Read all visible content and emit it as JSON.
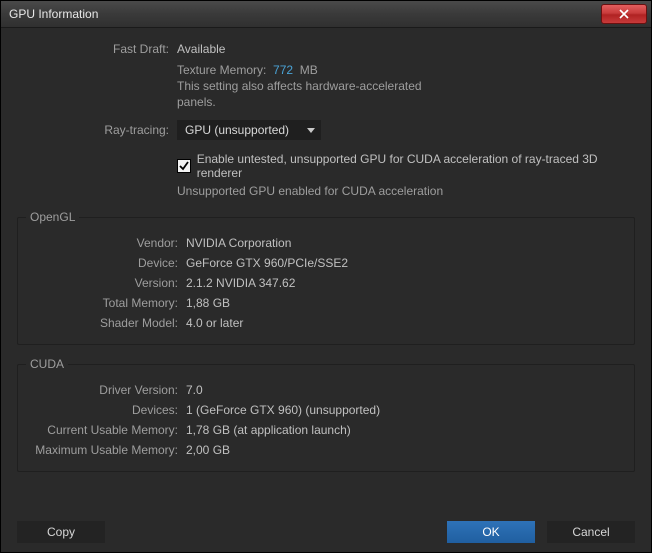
{
  "window": {
    "title": "GPU Information"
  },
  "top": {
    "fast_draft_label": "Fast Draft:",
    "fast_draft_value": "Available",
    "texture_memory_label": "Texture Memory:",
    "texture_memory_value": "772",
    "texture_memory_unit": "MB",
    "texture_memory_note": "This setting also affects hardware-accelerated panels.",
    "ray_tracing_label": "Ray-tracing:",
    "ray_tracing_selected": "GPU (unsupported)",
    "enable_untested_label": "Enable untested, unsupported GPU for CUDA acceleration of ray-traced 3D renderer",
    "status_text": "Unsupported GPU enabled for CUDA acceleration"
  },
  "opengl": {
    "legend": "OpenGL",
    "vendor_label": "Vendor:",
    "vendor_value": "NVIDIA Corporation",
    "device_label": "Device:",
    "device_value": "GeForce GTX 960/PCIe/SSE2",
    "version_label": "Version:",
    "version_value": "2.1.2 NVIDIA 347.62",
    "total_memory_label": "Total Memory:",
    "total_memory_value": "1,88 GB",
    "shader_model_label": "Shader Model:",
    "shader_model_value": "4.0 or later"
  },
  "cuda": {
    "legend": "CUDA",
    "driver_version_label": "Driver Version:",
    "driver_version_value": "7.0",
    "devices_label": "Devices:",
    "devices_value": "1 (GeForce GTX 960) (unsupported)",
    "current_usable_label": "Current Usable Memory:",
    "current_usable_value": "1,78 GB (at application launch)",
    "maximum_usable_label": "Maximum Usable Memory:",
    "maximum_usable_value": "2,00 GB"
  },
  "buttons": {
    "copy": "Copy",
    "ok": "OK",
    "cancel": "Cancel"
  }
}
